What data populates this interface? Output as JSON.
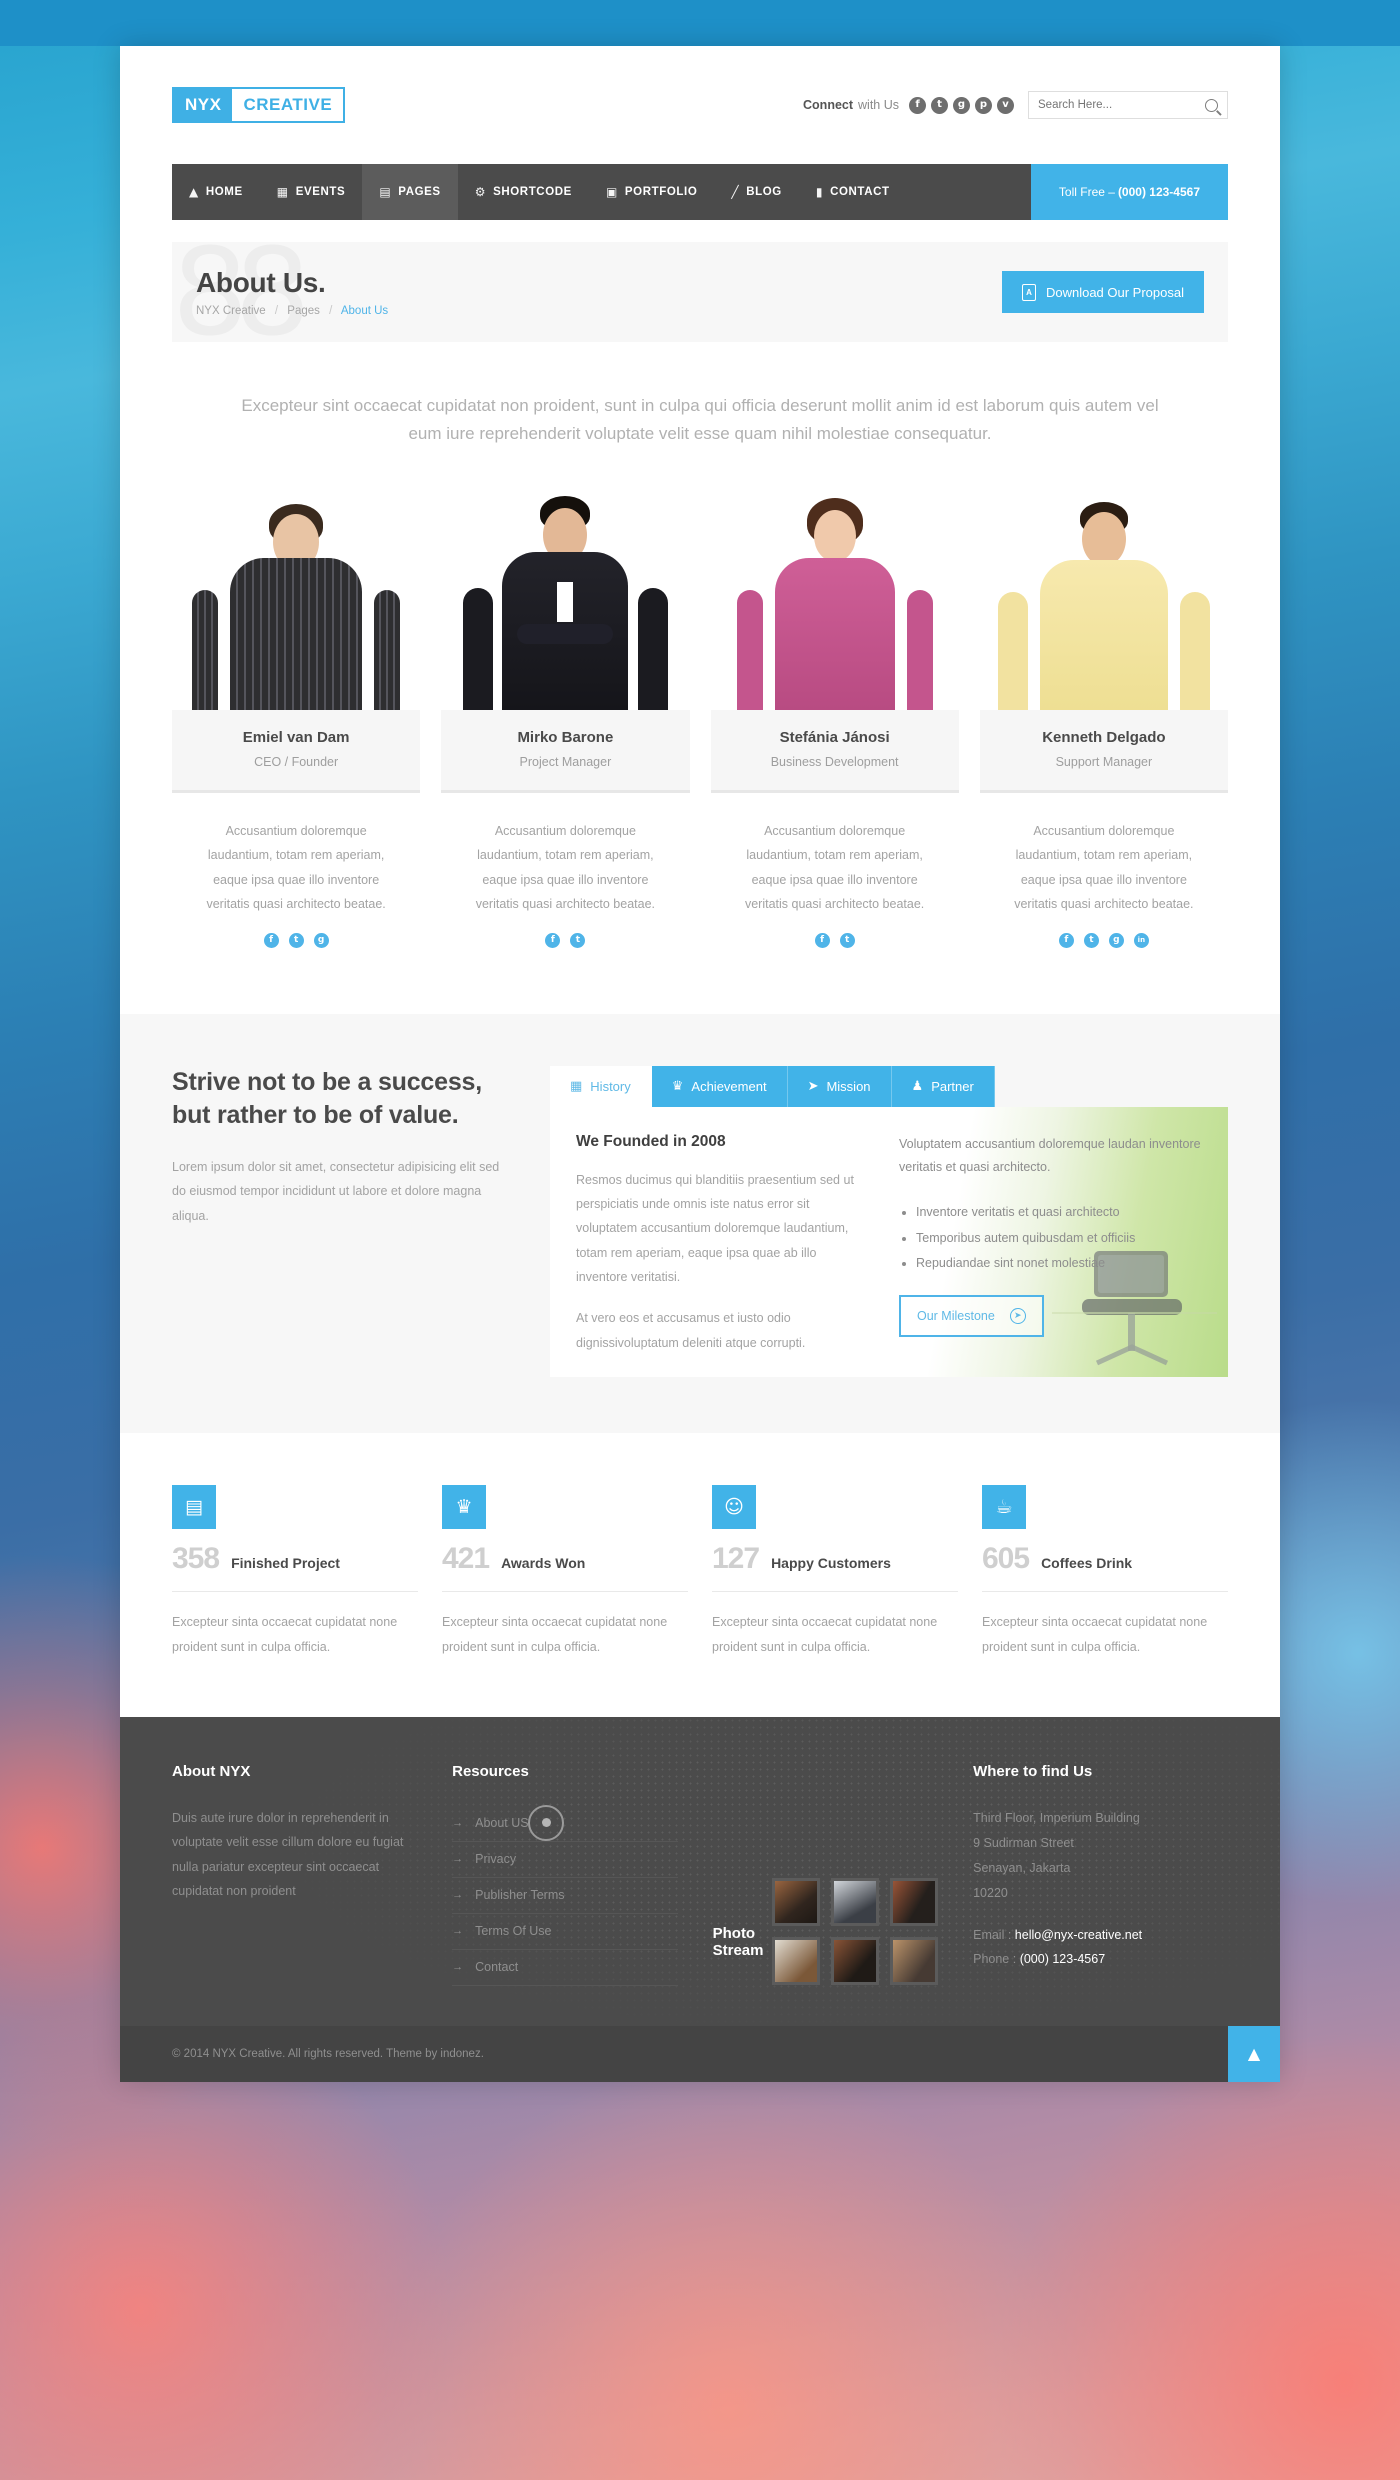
{
  "brand": {
    "nyx": "NYX",
    "creative": "CREATIVE"
  },
  "header": {
    "connect_bold": "Connect",
    "connect_rest": "with Us",
    "socials": [
      {
        "name": "facebook-icon",
        "glyph": "f"
      },
      {
        "name": "twitter-icon",
        "glyph": "t"
      },
      {
        "name": "google-plus-icon",
        "glyph": "g"
      },
      {
        "name": "pinterest-icon",
        "glyph": "p"
      },
      {
        "name": "vimeo-icon",
        "glyph": "v"
      }
    ],
    "search_placeholder": "Search Here..."
  },
  "nav": {
    "items": [
      {
        "label": "HOME",
        "icon": "home-icon",
        "glyph": "⌂",
        "active": false
      },
      {
        "label": "EVENTS",
        "icon": "calendar-icon",
        "glyph": "Ὄ5",
        "active": false
      },
      {
        "label": "PAGES",
        "icon": "document-icon",
        "glyph": "▤",
        "active": true
      },
      {
        "label": "SHORTCODE",
        "icon": "gear-icon",
        "glyph": "⚙",
        "active": false
      },
      {
        "label": "PORTFOLIO",
        "icon": "briefcase-icon",
        "glyph": "▣",
        "active": false
      },
      {
        "label": "BLOG",
        "icon": "pencil-icon",
        "glyph": "╱",
        "active": false
      },
      {
        "label": "CONTACT",
        "icon": "book-icon",
        "glyph": "▮",
        "active": false
      }
    ],
    "tollfree_label": "Toll Free – ",
    "tollfree_number": "(000) 123-4567"
  },
  "page": {
    "title": "About Us.",
    "breadcrumb": {
      "root": "NYX Creative",
      "parent": "Pages",
      "current": "About Us"
    },
    "download_button": "Download Our Proposal",
    "ghost_text": "88"
  },
  "intro": "Excepteur sint occaecat cupidatat non proident, sunt in culpa qui officia deserunt mollit anim id est laborum quis autem vel eum iure reprehenderit voluptate velit esse quam nihil molestiae consequatur.",
  "team": [
    {
      "name": "Emiel van Dam",
      "role": "CEO / Founder",
      "desc": "Accusantium doloremque laudantium, totam rem aperiam, eaque ipsa quae illo inventore veritatis quasi architecto beatae.",
      "socials": [
        {
          "name": "facebook-icon",
          "glyph": "f"
        },
        {
          "name": "twitter-icon",
          "glyph": "t"
        },
        {
          "name": "google-plus-icon",
          "glyph": "g"
        }
      ],
      "colors": {
        "skin": "#e8c4a4",
        "hair": "#3a2a1e",
        "shirt": "#2e2e30",
        "shirt2": "#4a4a4e"
      }
    },
    {
      "name": "Mirko Barone",
      "role": "Project Manager",
      "desc": "Accusantium doloremque laudantium, totam rem aperiam, eaque ipsa quae illo inventore veritatis quasi architecto beatae.",
      "socials": [
        {
          "name": "facebook-icon",
          "glyph": "f"
        },
        {
          "name": "twitter-icon",
          "glyph": "t"
        }
      ],
      "colors": {
        "skin": "#e3b896",
        "hair": "#15100c",
        "shirt": "#1b1b20",
        "shirt2": "#2a2a30"
      }
    },
    {
      "name": "Stefánia Jánosi",
      "role": "Business Development",
      "desc": "Accusantium doloremque laudantium, totam rem aperiam, eaque ipsa quae illo inventore veritatis quasi architecto beatae.",
      "socials": [
        {
          "name": "facebook-icon",
          "glyph": "f"
        },
        {
          "name": "twitter-icon",
          "glyph": "t"
        }
      ],
      "colors": {
        "skin": "#f0c9ab",
        "hair": "#4e2d1c",
        "shirt": "#c9578f",
        "shirt2": "#d munch"
      }
    },
    {
      "name": "Kenneth Delgado",
      "role": "Support Manager",
      "desc": "Accusantium doloremque laudantium, totam rem aperiam, eaque ipsa quae illo inventore veritatis quasi architecto beatae.",
      "socials": [
        {
          "name": "facebook-icon",
          "glyph": "f"
        },
        {
          "name": "twitter-icon",
          "glyph": "t"
        },
        {
          "name": "google-plus-icon",
          "glyph": "g"
        },
        {
          "name": "linkedin-icon",
          "glyph": "in"
        }
      ],
      "colors": {
        "skin": "#e7bd97",
        "hair": "#2b1d12",
        "shirt": "#f5e6a8",
        "shirt2": "#efdb92"
      }
    }
  ],
  "strive": {
    "heading": "Strive not to be a success, but rather to be of value.",
    "body": "Lorem ipsum dolor sit amet, consectetur adipisicing elit sed do eiusmod tempor incididunt ut labore et dolore magna aliqua."
  },
  "tabs": {
    "items": [
      {
        "label": "History",
        "icon": "building-icon",
        "glyph": "Ἶ2",
        "active": true
      },
      {
        "label": "Achievement",
        "icon": "trophy-icon",
        "glyph": "Ἴ6",
        "active": false
      },
      {
        "label": "Mission",
        "icon": "rocket-icon",
        "glyph": "➤",
        "active": false
      },
      {
        "label": "Partner",
        "icon": "user-icon",
        "glyph": "♟",
        "active": false
      }
    ],
    "panel": {
      "heading": "We Founded in 2008",
      "paragraph1": "Resmos ducimus qui blanditiis praesentium sed ut perspiciatis unde omnis iste natus error sit voluptatem accusantium doloremque laudantium, totam rem aperiam, eaque ipsa quae ab illo inventore veritatisi.",
      "paragraph2": "At vero eos et accusamus et iusto odio dignissivoluptatum deleniti atque corrupti.",
      "right_paragraph": "Voluptatem accusantium doloremque laudan inventore veritatis et quasi architecto.",
      "bullets": [
        "Inventore veritatis et quasi architecto",
        "Temporibus autem quibusdam et officiis",
        "Repudiandae sint nonet molestiae"
      ],
      "cta": "Our Milestone"
    }
  },
  "counters": [
    {
      "number": "358",
      "label": "Finished Project",
      "icon": "briefcase-icon",
      "glyph": "Ὃc",
      "text": "Excepteur sinta occaecat cupidatat none proident sunt in culpa officia."
    },
    {
      "number": "421",
      "label": "Awards Won",
      "icon": "trophy-icon",
      "glyph": "Ἴ6",
      "text": "Excepteur sinta occaecat cupidatat none proident sunt in culpa officia."
    },
    {
      "number": "127",
      "label": "Happy Customers",
      "icon": "smiley-icon",
      "glyph": "☺",
      "text": "Excepteur sinta occaecat cupidatat none proident sunt in culpa officia."
    },
    {
      "number": "605",
      "label": "Coffees Drink",
      "icon": "coffee-cup-icon",
      "glyph": "☕",
      "text": "Excepteur sinta occaecat cupidatat none proident sunt in culpa officia."
    }
  ],
  "footer": {
    "about": {
      "heading": "About NYX",
      "text": "Duis aute irure dolor in reprehenderit in voluptate velit esse cillum dolore eu fugiat nulla pariatur excepteur sint occaecat cupidatat non proident"
    },
    "resources": {
      "heading": "Resources",
      "links": [
        "About US",
        "Privacy",
        "Publisher Terms",
        "Terms Of Use",
        "Contact"
      ]
    },
    "photostream": {
      "heading": "Photo Stream",
      "photos": [
        {
          "name": "photo-thumb-1",
          "c1": "#8a5a3a",
          "c2": "#2d2420"
        },
        {
          "name": "photo-thumb-2",
          "c1": "#cfd3d8",
          "c2": "#3b3f46"
        },
        {
          "name": "photo-thumb-3",
          "c1": "#8f4f36",
          "c2": "#241f1c"
        },
        {
          "name": "photo-thumb-4",
          "c1": "#d9d4c8",
          "c2": "#6b4b32"
        },
        {
          "name": "photo-thumb-5",
          "c1": "#7a4a33",
          "c2": "#231c18"
        },
        {
          "name": "photo-thumb-6",
          "c1": "#b08a62",
          "c2": "#463a33"
        }
      ]
    },
    "find": {
      "heading": "Where to find Us",
      "address": [
        "Third Floor, Imperium Building",
        "9 Sudirman Street",
        "Senayan, Jakarta",
        "10220"
      ],
      "email_label": "Email :",
      "email": "hello@nyx-creative.net",
      "phone_label": "Phone :",
      "phone": "(000) 123-4567"
    },
    "copyright": "© 2014 NYX Creative. All rights reserved. Theme by indonez.",
    "to_top_glyph": "▲"
  },
  "colors": {
    "accent": "#41b3e8",
    "dark": "#4b4b4b",
    "panel": "#f7f7f7"
  }
}
